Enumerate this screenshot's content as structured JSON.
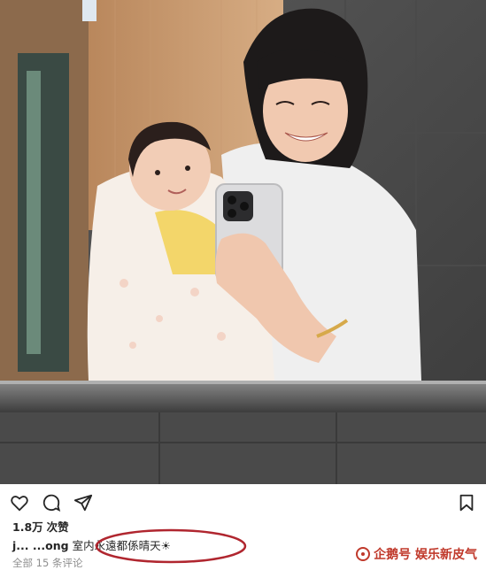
{
  "post": {
    "likes_count": "1.8万",
    "likes_label": "次赞",
    "username": "j... ...ong",
    "caption": "室内永遠都係晴天☀",
    "comments_link": "全部 15 条评论"
  },
  "watermark": {
    "text": "企鹅号 娱乐新皮气"
  },
  "icons": {
    "like": "heart-icon",
    "comment": "comment-icon",
    "share": "share-icon",
    "save": "bookmark-icon"
  },
  "colors": {
    "text": "#262626",
    "muted": "#8e8e8e",
    "annotation": "#b0262f"
  }
}
